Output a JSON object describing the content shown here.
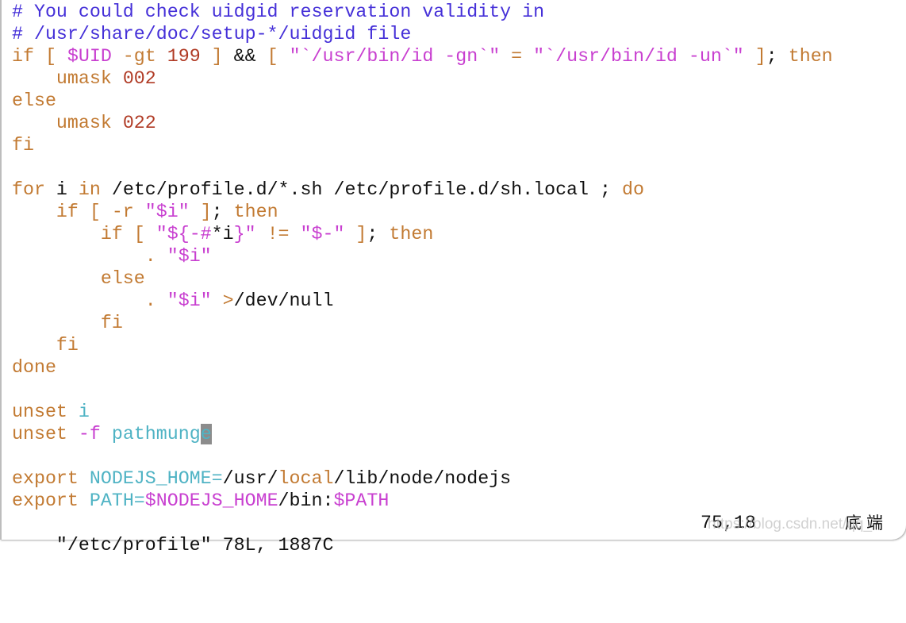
{
  "colors": {
    "keyword": "#c27a32",
    "string": "#c83fd0",
    "number": "#b03a24",
    "comment": "#4530d8",
    "identifier": "#4fb3c4",
    "text": "#111111",
    "cursor": "#8c8c8c"
  },
  "lines": [
    [
      {
        "t": "# You could check uidgid reservation validity in",
        "c": "cm"
      }
    ],
    [
      {
        "t": "# /usr/share/doc/setup-*/uidgid file",
        "c": "cm"
      }
    ],
    [
      {
        "t": "if [ ",
        "c": "k"
      },
      {
        "t": "$UID",
        "c": "m"
      },
      {
        "t": " -gt ",
        "c": "k"
      },
      {
        "t": "199",
        "c": "r"
      },
      {
        "t": " ] ",
        "c": "k"
      },
      {
        "t": "&&",
        "c": "b"
      },
      {
        "t": " [ ",
        "c": "k"
      },
      {
        "t": "\"`/usr/bin/id -gn`\"",
        "c": "m"
      },
      {
        "t": " = ",
        "c": "k"
      },
      {
        "t": "\"`/usr/bin/id -un`\"",
        "c": "m"
      },
      {
        "t": " ]",
        "c": "k"
      },
      {
        "t": "; ",
        "c": "b"
      },
      {
        "t": "then",
        "c": "k"
      }
    ],
    [
      {
        "t": "    umask ",
        "c": "k"
      },
      {
        "t": "002",
        "c": "r"
      }
    ],
    [
      {
        "t": "else",
        "c": "k"
      }
    ],
    [
      {
        "t": "    umask ",
        "c": "k"
      },
      {
        "t": "022",
        "c": "r"
      }
    ],
    [
      {
        "t": "fi",
        "c": "k"
      }
    ],
    [],
    [
      {
        "t": "for",
        "c": "k"
      },
      {
        "t": " i ",
        "c": "b"
      },
      {
        "t": "in",
        "c": "k"
      },
      {
        "t": " /etc/profile.d/*.sh /etc/profile.d/sh.local ; ",
        "c": "b"
      },
      {
        "t": "do",
        "c": "k"
      }
    ],
    [
      {
        "t": "    if [ -r ",
        "c": "k"
      },
      {
        "t": "\"$i\"",
        "c": "m"
      },
      {
        "t": " ]",
        "c": "k"
      },
      {
        "t": "; ",
        "c": "b"
      },
      {
        "t": "then",
        "c": "k"
      }
    ],
    [
      {
        "t": "        if [ ",
        "c": "k"
      },
      {
        "t": "\"${-#",
        "c": "m"
      },
      {
        "t": "*i",
        "c": "b"
      },
      {
        "t": "}\"",
        "c": "m"
      },
      {
        "t": " != ",
        "c": "k"
      },
      {
        "t": "\"$-\"",
        "c": "m"
      },
      {
        "t": " ]",
        "c": "k"
      },
      {
        "t": "; ",
        "c": "b"
      },
      {
        "t": "then",
        "c": "k"
      }
    ],
    [
      {
        "t": "            . ",
        "c": "k"
      },
      {
        "t": "\"$i\"",
        "c": "m"
      }
    ],
    [
      {
        "t": "        else",
        "c": "k"
      }
    ],
    [
      {
        "t": "            . ",
        "c": "k"
      },
      {
        "t": "\"$i\"",
        "c": "m"
      },
      {
        "t": " >",
        "c": "k"
      },
      {
        "t": "/dev/null",
        "c": "b"
      }
    ],
    [
      {
        "t": "        fi",
        "c": "k"
      }
    ],
    [
      {
        "t": "    fi",
        "c": "k"
      }
    ],
    [
      {
        "t": "done",
        "c": "k"
      }
    ],
    [],
    [
      {
        "t": "unset ",
        "c": "k"
      },
      {
        "t": "i",
        "c": "c"
      }
    ],
    [
      {
        "t": "unset ",
        "c": "k"
      },
      {
        "t": "-f",
        "c": "m"
      },
      {
        "t": " pathmung",
        "c": "c"
      },
      {
        "t": "e",
        "c": "c cursor"
      }
    ],
    [],
    [
      {
        "t": "export ",
        "c": "k"
      },
      {
        "t": "NODEJS_HOME=",
        "c": "c"
      },
      {
        "t": "/usr/",
        "c": "b"
      },
      {
        "t": "local",
        "c": "k"
      },
      {
        "t": "/lib/node/nodejs",
        "c": "b"
      }
    ],
    [
      {
        "t": "export ",
        "c": "k"
      },
      {
        "t": "PATH=",
        "c": "c"
      },
      {
        "t": "$NODEJS_HOME",
        "c": "m"
      },
      {
        "t": "/bin:",
        "c": "b"
      },
      {
        "t": "$PATH",
        "c": "m"
      }
    ]
  ],
  "status": {
    "file_info": "\"/etc/profile\" 78L, 1887C",
    "cursor_position": "75,18",
    "scroll_position": "底端"
  },
  "watermark": "https://blog.csdn.net/qq_"
}
